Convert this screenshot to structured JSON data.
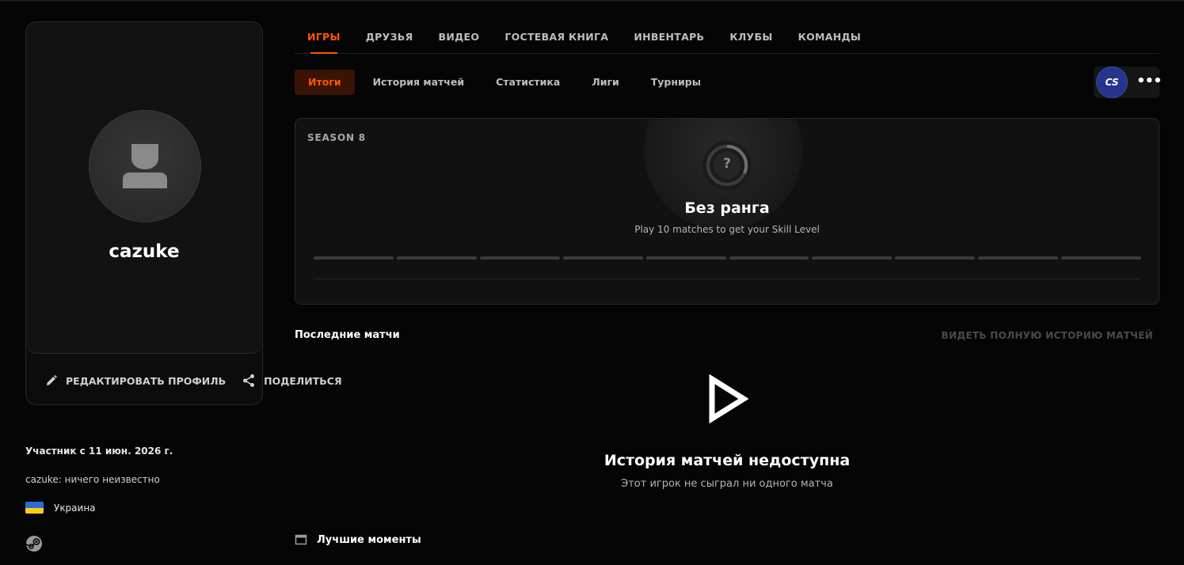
{
  "profile": {
    "username": "cazuke",
    "edit_label": "РЕДАКТИРОВАТЬ ПРОФИЛЬ",
    "share_label": "ПОДЕЛИТЬСЯ",
    "member_since": "Участник с 11 июн. 2026 г.",
    "bio": "cazuke: ничего неизвестно",
    "country": "Украина",
    "avatar_icon": "user-placeholder-icon",
    "steam_icon": "steam-icon"
  },
  "main_tabs": [
    "ИГРЫ",
    "ДРУЗЬЯ",
    "ВИДЕО",
    "ГОСТЕВАЯ КНИГА",
    "ИНВЕНТАРЬ",
    "КЛУБЫ",
    "КОМАНДЫ"
  ],
  "main_tab_active": "ИГРЫ",
  "sub_tabs": [
    "Итоги",
    "История матчей",
    "Статистика",
    "Лиги",
    "Турниры"
  ],
  "sub_tab_active": "Итоги",
  "game_switch": {
    "logo_text": "CS",
    "more_icon": "more-dots-icon"
  },
  "season": {
    "label": "SEASON 8",
    "rank_title": "Без ранга",
    "rank_subtitle": "Play 10 matches to get your Skill Level",
    "rank_icon_text": "?",
    "level_segments": 10
  },
  "recent": {
    "title": "Последние матчи",
    "full_history_label": "ВИДЕТЬ ПОЛНУЮ ИСТОРИЮ МАТЧЕЙ",
    "empty_title": "История матчей недоступна",
    "empty_subtitle": "Этот игрок не сыграл ни одного матча"
  },
  "highlights": {
    "title": "Лучшие моменты"
  },
  "colors": {
    "accent": "#ff5500",
    "accent_bg": "#3a1306",
    "background": "#050505",
    "card": "#111111",
    "cs_logo": "#27348b",
    "flag_blue": "#2f6bd6",
    "flag_yellow": "#f7cf1e"
  }
}
